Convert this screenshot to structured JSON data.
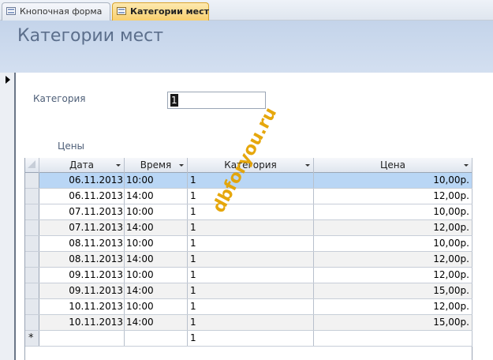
{
  "tabs": [
    {
      "label": "Кнопочная форма",
      "active": false
    },
    {
      "label": "Категории мест",
      "active": true
    }
  ],
  "form": {
    "title": "Категории мест",
    "category_label": "Категория",
    "category_value": "1",
    "subform_label": "Цены"
  },
  "grid": {
    "columns": [
      "Дата",
      "Время",
      "Категория",
      "Цена"
    ],
    "rows": [
      {
        "date": "06.11.2013",
        "time": "10:00",
        "category": "1",
        "price": "10,00р."
      },
      {
        "date": "06.11.2013",
        "time": "14:00",
        "category": "1",
        "price": "12,00р."
      },
      {
        "date": "07.11.2013",
        "time": "10:00",
        "category": "1",
        "price": "10,00р."
      },
      {
        "date": "07.11.2013",
        "time": "14:00",
        "category": "1",
        "price": "12,00р."
      },
      {
        "date": "08.11.2013",
        "time": "10:00",
        "category": "1",
        "price": "10,00р."
      },
      {
        "date": "08.11.2013",
        "time": "14:00",
        "category": "1",
        "price": "12,00р."
      },
      {
        "date": "09.11.2013",
        "time": "10:00",
        "category": "1",
        "price": "12,00р."
      },
      {
        "date": "09.11.2013",
        "time": "14:00",
        "category": "1",
        "price": "15,00р."
      },
      {
        "date": "10.11.2013",
        "time": "10:00",
        "category": "1",
        "price": "12,00р."
      },
      {
        "date": "10.11.2013",
        "time": "14:00",
        "category": "1",
        "price": "15,00р."
      }
    ],
    "new_row": {
      "marker": "*",
      "category": "1"
    }
  },
  "watermark": "dbforyou.ru",
  "colors": {
    "header_band": "#c4d4ea",
    "active_tab": "#f9cf6d",
    "selected_row": "#b9d6f5",
    "watermark": "#e5a300"
  }
}
